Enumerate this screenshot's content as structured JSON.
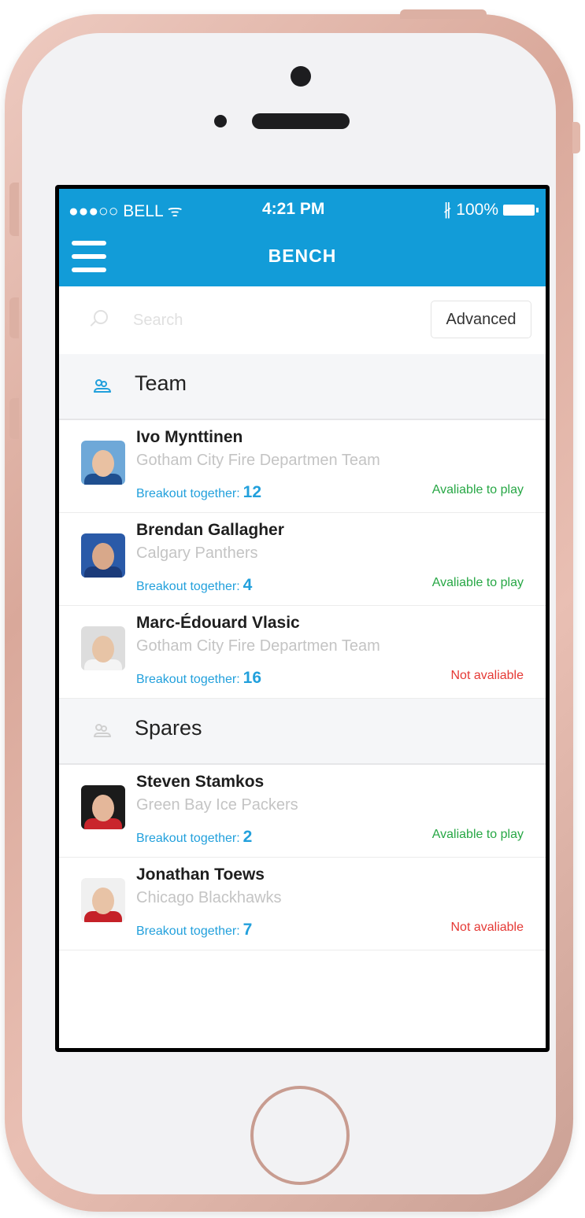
{
  "status_bar": {
    "carrier": "●●●○○ BELL ᯤ",
    "time": "4:21 PM",
    "battery": "∦ 100%"
  },
  "header": {
    "title": "BENCH"
  },
  "search": {
    "placeholder": "Search",
    "advanced_label": "Advanced"
  },
  "sections": [
    {
      "label": "Team",
      "icon_color": "#22a0dc",
      "players": [
        {
          "name": "Ivo Mynttinen",
          "team": "Gotham City Fire Departmen Team",
          "breakout_label": "Breakout together:",
          "breakout_count": "12",
          "status": "Avaliable to play",
          "status_color": "#27a745",
          "avatar": "player-photo"
        },
        {
          "name": "Brendan Gallagher",
          "team": "Calgary Panthers",
          "breakout_label": "Breakout together:",
          "breakout_count": "4",
          "status": "Avaliable to play",
          "status_color": "#27a745",
          "avatar": "player-photo"
        },
        {
          "name": "Marc-Édouard Vlasic",
          "team": "Gotham City Fire Departmen Team",
          "breakout_label": "Breakout together:",
          "breakout_count": "16",
          "status": "Not avaliable",
          "status_color": "#e53935",
          "avatar": "player-photo"
        }
      ]
    },
    {
      "label": "Spares",
      "icon_color": "#d0d0d0",
      "players": [
        {
          "name": "Steven Stamkos",
          "team": "Green Bay Ice Packers",
          "breakout_label": "Breakout together:",
          "breakout_count": "2",
          "status": "Avaliable to play",
          "status_color": "#27a745",
          "avatar": "player-photo"
        },
        {
          "name": "Jonathan Toews",
          "team": "Chicago Blackhawks",
          "breakout_label": "Breakout together:",
          "breakout_count": "7",
          "status": "Not avaliable",
          "status_color": "#e53935",
          "avatar": "player-photo"
        }
      ]
    }
  ],
  "colors": {
    "accent": "#129cd8",
    "link": "#22a0dc",
    "available": "#27a745",
    "unavailable": "#e53935"
  },
  "icons": [
    "menu-icon",
    "search-icon",
    "people-icon",
    "wifi-icon",
    "bluetooth-icon",
    "battery-icon"
  ]
}
